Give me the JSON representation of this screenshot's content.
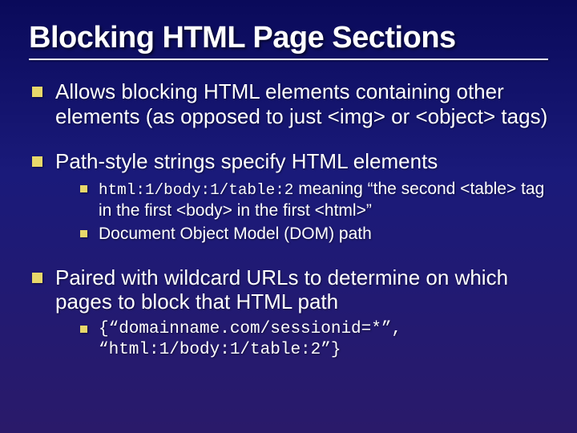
{
  "title": "Blocking HTML Page Sections",
  "bullets": {
    "b1": "Allows blocking HTML elements containing other elements (as opposed to just <img> or <object> tags)",
    "b2": "Path-style strings specify HTML elements",
    "b2_sub": {
      "s1_code": "html:1/body:1/table:2",
      "s1_rest": " meaning “the second <table> tag in the first <body> in the first <html>”",
      "s2": "Document Object Model (DOM) path"
    },
    "b3": "Paired with wildcard URLs to determine on which pages to block that HTML path",
    "b3_sub": {
      "s1": "{“domainname.com/sessionid=*”, “html:1/body:1/table:2”}"
    }
  }
}
